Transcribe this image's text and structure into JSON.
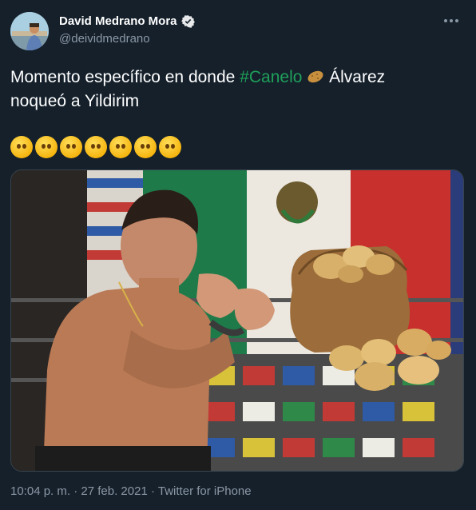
{
  "author": {
    "display_name": "David Medrano Mora",
    "handle": "@deividmedrano",
    "verified": true
  },
  "tweet": {
    "text_before": "Momento específico en donde ",
    "hashtag": "#Canelo",
    "text_after_line1": " Álvarez",
    "text_line2": "noqueó a Yildirim",
    "emoji_count": 7,
    "emoji_name": "face-without-mouth-emoji"
  },
  "media": {
    "description_icon": "boxer-with-potato-sack-photo"
  },
  "meta": {
    "time": "10:04 p. m.",
    "separator": "·",
    "date": "27 feb. 2021",
    "source": "Twitter for iPhone"
  },
  "colors": {
    "background": "#15202b",
    "hashtag": "#1fa05a",
    "secondary_text": "#8b98a5"
  }
}
